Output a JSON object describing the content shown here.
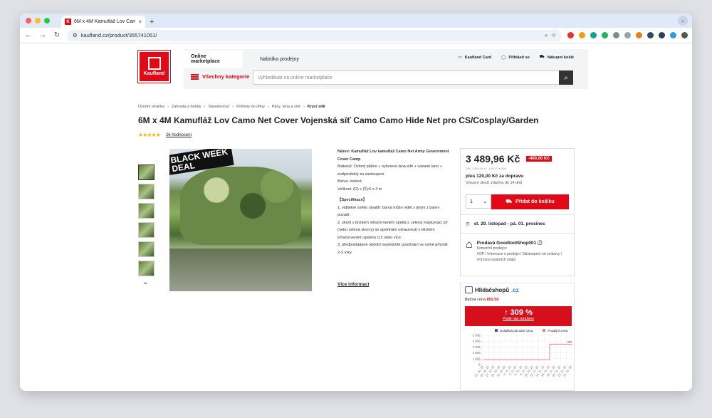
{
  "browser": {
    "tab_title": "6M x 4M Kamufláž Lov Camo",
    "tab_close": "×",
    "new_tab": "+",
    "url": "kaufland.cz/product/355741051/",
    "back": "←",
    "forward": "→",
    "reload": "↻"
  },
  "brand": {
    "name": "Kaufland",
    "color": "#e10915"
  },
  "header": {
    "tab_active": "Online marketplace",
    "tab_other": "Nabídka prodejny",
    "kaufland_card": "Kaufland Card",
    "login": "Přihlásit se",
    "cart": "Nákupní košík",
    "categories": "Všechny kategorie",
    "search_placeholder": "Vyhledávat na online marketplace"
  },
  "breadcrumb": [
    "Úvodní stránka",
    "Zahrada a hobby",
    "Stavebnictví",
    "Potřeby do dílny",
    "Pásy, lana a sítě",
    "Krycí sítě"
  ],
  "product": {
    "title": "6M x 4M Kamufláž Lov Camo Net Cover Vojenská síť Camo Camo Hide Net pro CS/Cosplay/Garden",
    "stars": "★★★★★",
    "reviews": "26 hodnocení",
    "badge_line1": "BLACK WEEK",
    "badge_line2": "DEAL"
  },
  "description": {
    "name": "Název: Kamufláž Lov kamufláž Camo Net Army Government Cover Camp",
    "material": "Materiál: Oxford plátno + nylonová lana sítě + vázané lano + zodpovědný za zastoupení",
    "color": "Barva: zelená",
    "size": "Velikost: (D) x (Š):6 x 4 m",
    "spec_head": "【Specifikace】",
    "spec1": "1, viditelné světlo stealth: barva může vidět s jiným z barev pozadí.",
    "spec2": "2, skrytí v blízkém infračerveném spektru: zelená maskovací síť (nebo zelená skvrny) se spektrální odrazivostí v blízkém infračerveném spektru 0,5 nebo více.",
    "spec3": "3, předpokládané období nepřetržité používání ve volné přírodě 2-3 roky",
    "more": "Více informací"
  },
  "buybox": {
    "price": "3 489,96 Kč",
    "discount": "-400,00 Kč",
    "old_price": "DPC 3 889,96 Kč · (145,42 Kč/ks)",
    "shipping": "plus 120,00 Kč za dopravu",
    "returns": "Vrácení zboží zdarma do 14 dnů",
    "qty": "1",
    "add_to_cart": "Přidat do košíku",
    "delivery": "st. 29. listopad - pá. 01. prosinec",
    "seller": "Prodává GoodtoolShop001",
    "seller_type": "Komerční prodejce",
    "seller_links": "VOP / Informace o prodejci / Odstoupení od smlouvy / Ochrana osobních údajů"
  },
  "hlidac": {
    "logo_main": "Hlídačshopů",
    "logo_tld": ".cz",
    "normal_label": "Běžná cena",
    "normal_value": "852,50",
    "change": "↑ 309 %",
    "change_link": "Podle nás zdraženo",
    "legend_claimed": "Uváděná původní cena",
    "legend_sale": "Prodejní cena"
  },
  "chart_data": {
    "type": "line",
    "x": [
      "23. 10. 23",
      "25. 10. 23",
      "27. 10. 23",
      "29. 10. 23",
      "31. 10. 23",
      "2. 11. 23",
      "4. 11. 23",
      "6. 11. 23",
      "8. 11. 23",
      "10. 11. 23",
      "12. 11. 23",
      "14. 11. 23",
      "16. 11. 23",
      "18. 11. 23",
      "20. 11. 23",
      "22. 11. 23",
      "24. 11. 23"
    ],
    "series": [
      {
        "name": "Uváděná původní cena",
        "values": [
          null,
          null,
          null,
          null,
          null,
          null,
          null,
          null,
          null,
          null,
          null,
          null,
          null,
          null,
          null,
          null,
          3890
        ]
      },
      {
        "name": "Prodejní cena",
        "values": [
          853,
          853,
          853,
          853,
          853,
          853,
          853,
          853,
          853,
          853,
          853,
          853,
          3490,
          3490,
          3490,
          3490,
          3490
        ]
      }
    ],
    "y_ticks": [
      "5 000,-",
      "4 000,-",
      "3 000,-",
      "2 000,-",
      "1 000,-",
      "0,-"
    ],
    "ylim": [
      0,
      5000
    ],
    "colors": {
      "claimed": "#5b4bbd",
      "sale": "#e88a8a"
    },
    "grid": true,
    "legend": "top"
  }
}
